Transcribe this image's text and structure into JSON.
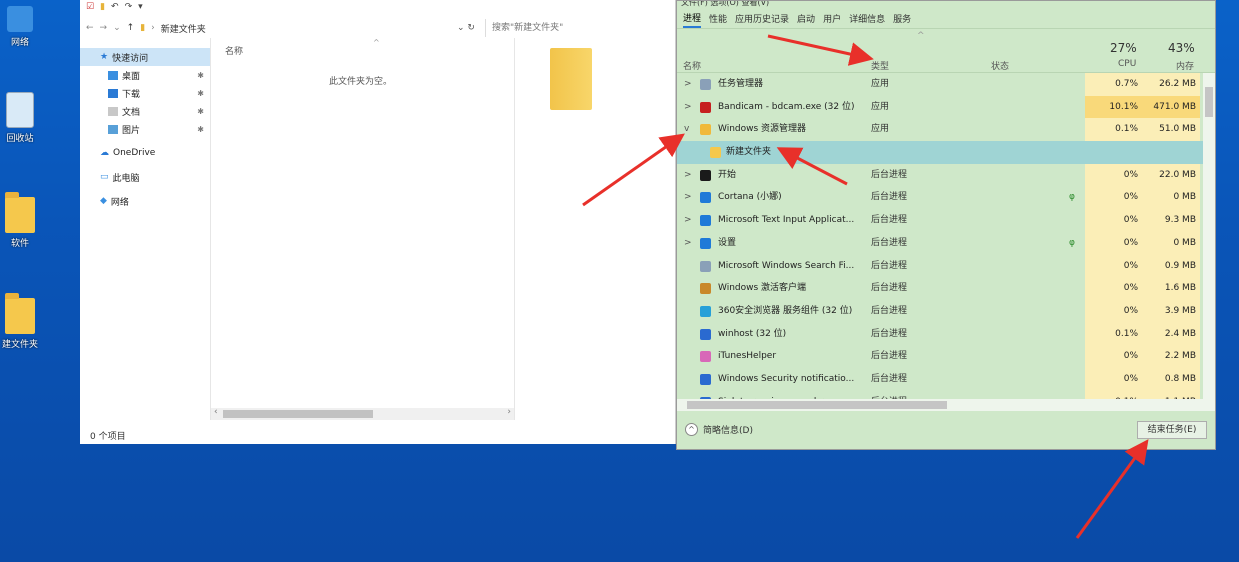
{
  "desktop": {
    "icons": [
      {
        "label": "网络"
      },
      {
        "label": "回收站"
      },
      {
        "label": "软件"
      },
      {
        "label": "建文件夹"
      }
    ]
  },
  "explorer": {
    "address_path": "新建文件夹",
    "search_placeholder": "搜索\"新建文件夹\"",
    "nav": [
      {
        "label": "快速访问",
        "icon": "star-icon",
        "selected": true
      },
      {
        "label": "桌面",
        "icon": "desktop-folder-icon",
        "pinned": true
      },
      {
        "label": "下载",
        "icon": "download-folder-icon",
        "pinned": true
      },
      {
        "label": "文档",
        "icon": "document-folder-icon",
        "pinned": true
      },
      {
        "label": "图片",
        "icon": "picture-folder-icon",
        "pinned": true
      },
      {
        "label": "OneDrive",
        "icon": "cloud-icon"
      },
      {
        "label": "此电脑",
        "icon": "computer-icon"
      },
      {
        "label": "网络",
        "icon": "network-icon"
      }
    ],
    "column_name": "名称",
    "empty_message": "此文件夹为空。",
    "status": "0 个项目"
  },
  "task_manager": {
    "menu_text": "文件(F) 选项(O) 查看(V)",
    "tabs": [
      "进程",
      "性能",
      "应用历史记录",
      "启动",
      "用户",
      "详细信息",
      "服务"
    ],
    "active_tab": "进程",
    "headers": {
      "name": "名称",
      "type": "类型",
      "status": "状态",
      "cpu_pct": "27%",
      "cpu": "CPU",
      "mem_pct": "43%",
      "mem": "内存"
    },
    "rows": [
      {
        "expand": ">",
        "name": "任务管理器",
        "type": "应用",
        "eco": "",
        "cpu": "0.7%",
        "mem": "26.2 MB",
        "color": "#8aa0b8"
      },
      {
        "expand": ">",
        "name": "Bandicam - bdcam.exe (32 位)",
        "type": "应用",
        "eco": "",
        "cpu": "10.1%",
        "mem": "471.0 MB",
        "color": "#c62020"
      },
      {
        "expand": "v",
        "name": "Windows 资源管理器",
        "type": "应用",
        "eco": "",
        "cpu": "0.1%",
        "mem": "51.0 MB",
        "color": "#f0b93a"
      },
      {
        "expand": "",
        "name": "新建文件夹",
        "type": "",
        "eco": "",
        "cpu": "",
        "mem": "",
        "color": "#f5c84c",
        "sub": true,
        "selected": true
      },
      {
        "expand": ">",
        "name": "开始",
        "type": "后台进程",
        "eco": "",
        "cpu": "0%",
        "mem": "22.0 MB",
        "color": "#1a1a1a"
      },
      {
        "expand": ">",
        "name": "Cortana (小娜)",
        "type": "后台进程",
        "eco": "φ",
        "cpu": "0%",
        "mem": "0 MB",
        "color": "#1f7ad8"
      },
      {
        "expand": ">",
        "name": "Microsoft Text Input Applicat...",
        "type": "后台进程",
        "eco": "",
        "cpu": "0%",
        "mem": "9.3 MB",
        "color": "#1f7ad8"
      },
      {
        "expand": ">",
        "name": "设置",
        "type": "后台进程",
        "eco": "φ",
        "cpu": "0%",
        "mem": "0 MB",
        "color": "#1f7ad8"
      },
      {
        "expand": "",
        "name": "Microsoft Windows Search Fi...",
        "type": "后台进程",
        "eco": "",
        "cpu": "0%",
        "mem": "0.9 MB",
        "color": "#8aa0b8"
      },
      {
        "expand": "",
        "name": "Windows 激活客户端",
        "type": "后台进程",
        "eco": "",
        "cpu": "0%",
        "mem": "1.6 MB",
        "color": "#c9882a"
      },
      {
        "expand": "",
        "name": "360安全浏览器 服务组件 (32 位)",
        "type": "后台进程",
        "eco": "",
        "cpu": "0%",
        "mem": "3.9 MB",
        "color": "#27a0d8"
      },
      {
        "expand": "",
        "name": "winhost (32 位)",
        "type": "后台进程",
        "eco": "",
        "cpu": "0.1%",
        "mem": "2.4 MB",
        "color": "#2a6ad0"
      },
      {
        "expand": "",
        "name": "iTunesHelper",
        "type": "后台进程",
        "eco": "",
        "cpu": "0%",
        "mem": "2.2 MB",
        "color": "#d868b8"
      },
      {
        "expand": "",
        "name": "Windows Security notificatio...",
        "type": "后台进程",
        "eco": "",
        "cpu": "0%",
        "mem": "0.8 MB",
        "color": "#2a6ad0"
      },
      {
        "expand": "",
        "name": "Sink to receive asynchronous ...",
        "type": "后台进程",
        "eco": "",
        "cpu": "0.1%",
        "mem": "1.1 MB",
        "color": "#2a6ad0"
      }
    ],
    "fewer_details": "简略信息(D)",
    "end_task": "结束任务(E)",
    "accent": "#2a7ad5",
    "annotation_color": "#e8302a"
  }
}
